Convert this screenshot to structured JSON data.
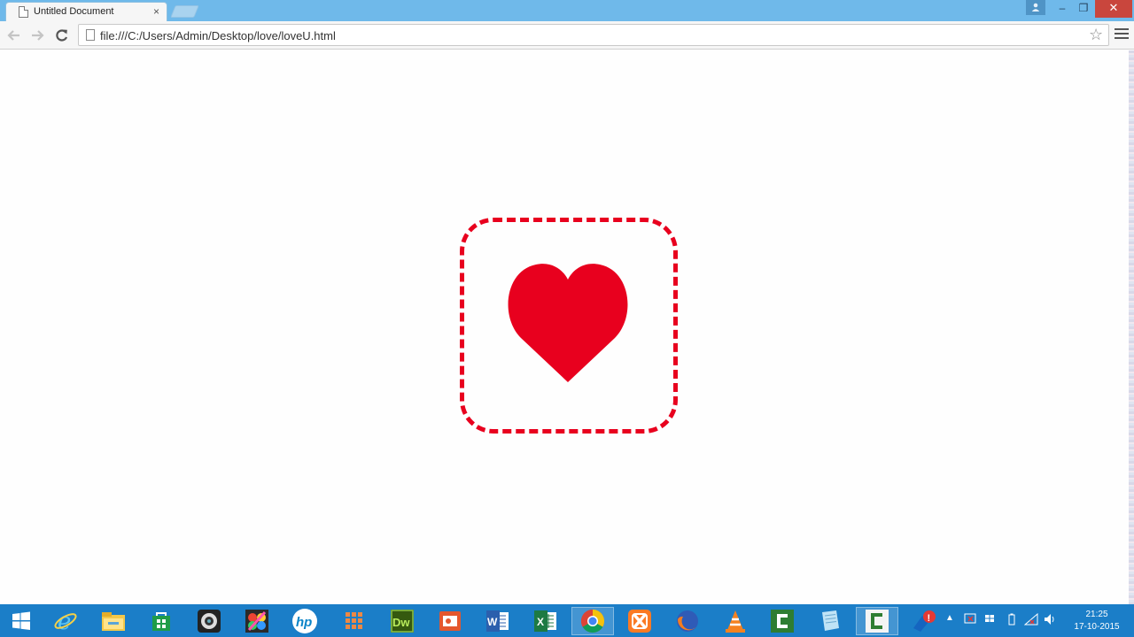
{
  "browser": {
    "tab_title": "Untitled Document",
    "tab_close": "×",
    "url": "file:///C:/Users/Admin/Desktop/love/loveU.html",
    "star": "☆",
    "window_min": "–",
    "window_max": "❐",
    "window_close": "✕"
  },
  "page": {
    "heart_color": "#e8001e"
  },
  "taskbar": {
    "time": "21:25",
    "date": "17-10-2015",
    "apps": [
      "windows-start",
      "internet-explorer",
      "file-explorer",
      "store",
      "camera",
      "paint",
      "hp",
      "apps-grid",
      "dreamweaver",
      "presentation",
      "word",
      "excel",
      "chrome",
      "xampp",
      "firefox",
      "vlc",
      "camtasia",
      "notepad",
      "camtasia-recorder",
      "security"
    ]
  }
}
